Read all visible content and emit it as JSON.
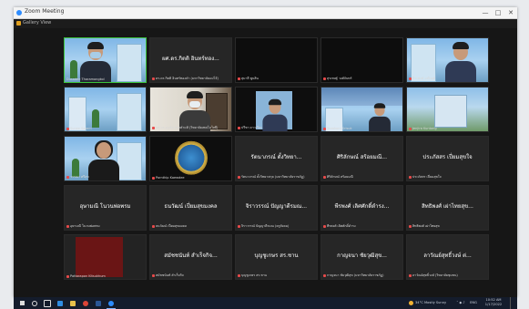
{
  "window": {
    "title": "Zoom Meeting",
    "view_label": "Gallery View",
    "controls": {
      "minimize": "—",
      "maximize": "□",
      "close": "✕"
    }
  },
  "tiles": [
    {
      "type": "video",
      "scene": "masked",
      "label": "Dusadee Tharamongkol",
      "muted": false,
      "active": true
    },
    {
      "type": "name",
      "name": "ผศ.ดร.กิตติ อินทร์ทอง...",
      "label": "ดร.ดร.กิตติ อินทร์ทองคำ (มหาวิทยาลัยแม่โจ้)",
      "muted": true
    },
    {
      "type": "blank",
      "label": "สุมาลี พูนสิน",
      "muted": true
    },
    {
      "type": "blank",
      "label": "สุรเชษฐ์ วงศ์จันทร์",
      "muted": true
    },
    {
      "type": "video",
      "scene": "suit",
      "label": "ธีระพงษ์ มณีวงค์",
      "muted": true
    },
    {
      "type": "video",
      "scene": "campus-empty",
      "label": "Sunee Sapsin",
      "muted": true
    },
    {
      "type": "video",
      "scene": "office",
      "label": "ผศ.ดร.อนุชิต ทองคำแท้ (วิทยาลัยเทคโนโลยี)",
      "muted": true
    },
    {
      "type": "video",
      "scene": "suit-small",
      "label": "ปรีชา ดาวเรือง",
      "muted": true
    },
    {
      "type": "video",
      "scene": "campus-head",
      "label": "Tanakorn Srisuk",
      "muted": true
    },
    {
      "type": "video",
      "scene": "campus-building",
      "label": "Jenjira Kuntong",
      "muted": true
    },
    {
      "type": "video",
      "scene": "woman",
      "label": "วรรณา ศรีสุข",
      "muted": true
    },
    {
      "type": "video",
      "scene": "emblem",
      "label": "Pornthip Kaewdee",
      "muted": true
    },
    {
      "type": "name",
      "name": "รัตนาภรณ์ ตั้งวิทยา...",
      "label": "รัตนาภรณ์ ตั้งวิทยาสกุล (มหาวิทยาลัยราชภัฏ)",
      "muted": true
    },
    {
      "type": "name",
      "name": "ศิริลักษณ์ สร้อยมณี...",
      "label": "ศิริลักษณ์ สร้อยมณี",
      "muted": true
    },
    {
      "type": "name",
      "name": "ประภัสสร เปี่ยมสุขใจ",
      "label": "ประภัสสร เปี่ยมสุขใจ",
      "muted": true
    },
    {
      "type": "name",
      "name": "อุษามณี โนวนพ่อพรม",
      "label": "อุษามณี โนวนพ่อพรม",
      "muted": true
    },
    {
      "type": "name",
      "name": "ธนวัฒน์ เปี่ยมสุขมงคล",
      "label": "ธนวัฒน์ เปี่ยมสุขมงคล",
      "muted": true
    },
    {
      "type": "name",
      "name": "จิราวรรณ์ ปัญญาดีรมณ...",
      "label": "จิราวรรณ์ ปัญญาดีรมณ (ครูสังคม)",
      "muted": true
    },
    {
      "type": "name",
      "name": "พีรพงศ์ เลิศศักดิ์ดำรง...",
      "label": "พีรพงศ์ เลิศศักดิ์ดำรง",
      "muted": true
    },
    {
      "type": "name",
      "name": "สิทธิพงศ์ เผ่าไทยสุข...",
      "label": "สิทธิพงศ์ เผ่าไทยสุข",
      "muted": true
    },
    {
      "type": "video",
      "scene": "red",
      "label": "Pattarapon Kitsukhum",
      "muted": true
    },
    {
      "type": "name",
      "name": "สมัชชนันท์ สำเร็จกิจ...",
      "label": "สมัชชนันท์ สำเร็จกิจ",
      "muted": true
    },
    {
      "type": "name",
      "name": "บุญชูเกษร สร.ชาน",
      "label": "บุญชูเกษร สร.ชาน",
      "muted": true
    },
    {
      "type": "name",
      "name": "กาญจนา ชัยวุฒิสุข...",
      "label": "กาญจนา ชัยวุฒิสุข (มหาวิทยาลัยราชภัฏ)",
      "muted": true
    },
    {
      "type": "name",
      "name": "ลาวัณย์สุทธิ์วงษ์ ต่...",
      "label": "ลาวัณย์สุทธิ์วงษ์ (วิทยาลัยชุมชน)",
      "muted": true
    }
  ],
  "taskbar": {
    "weather": "34°C Mostly Sunny",
    "language": "ENG",
    "time": "10:52 AM",
    "date": "1/17/2022"
  },
  "colors": {
    "window_bg": "#161616",
    "tile_bg": "#262626",
    "active_border": "#3cc43c",
    "taskbar_bg": "#141c2c"
  }
}
